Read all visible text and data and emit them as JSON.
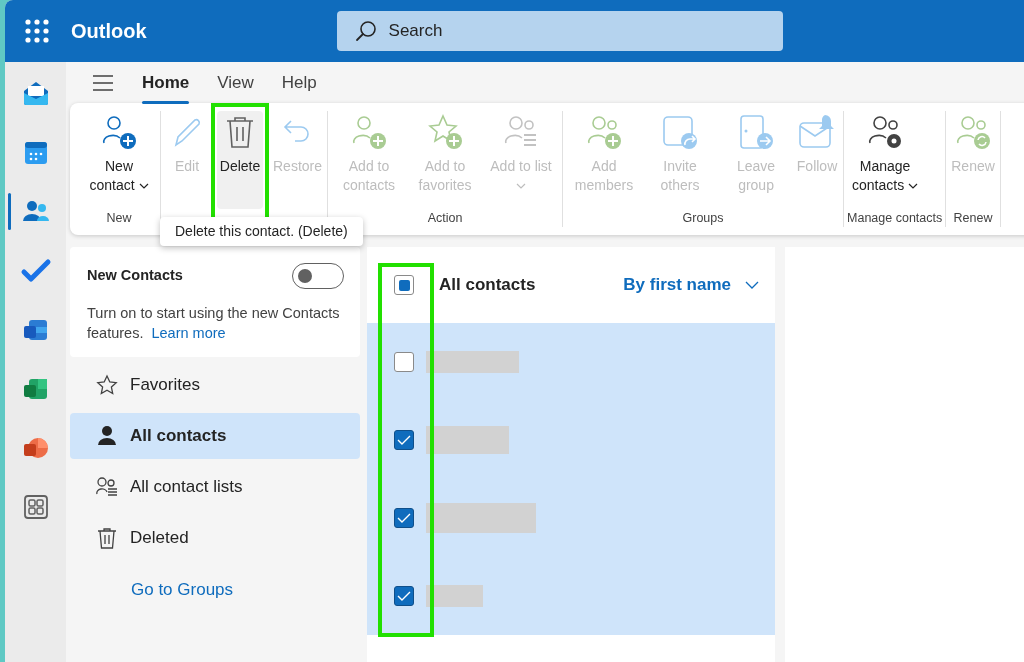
{
  "header": {
    "app_name": "Outlook",
    "search": {
      "placeholder": "Search"
    }
  },
  "app_rail": [
    {
      "kind": "mail",
      "selected": false
    },
    {
      "kind": "calendar",
      "selected": false
    },
    {
      "kind": "people",
      "selected": true
    },
    {
      "kind": "todo",
      "selected": false
    },
    {
      "kind": "word",
      "selected": false
    },
    {
      "kind": "excel",
      "selected": false
    },
    {
      "kind": "powerpoint",
      "selected": false
    },
    {
      "kind": "apps",
      "selected": false
    }
  ],
  "tabs": [
    {
      "label": "Home",
      "selected": true
    },
    {
      "label": "View",
      "selected": false
    },
    {
      "label": "Help",
      "selected": false
    }
  ],
  "ribbon": {
    "groups": [
      {
        "label": "New",
        "buttons": [
          {
            "kind": "new-contact",
            "label": "New contact",
            "dropdown": true,
            "disabled": false,
            "highlighted": false
          }
        ]
      },
      {
        "buttons": [
          {
            "kind": "edit",
            "label": "Edit",
            "dropdown": false,
            "disabled": true,
            "highlighted": false
          }
        ]
      },
      {
        "buttons": [
          {
            "kind": "delete",
            "label": "Delete",
            "dropdown": false,
            "disabled": false,
            "highlighted": true
          },
          {
            "kind": "restore",
            "label": "Restore",
            "dropdown": false,
            "disabled": true,
            "highlighted": false
          }
        ]
      },
      {
        "label": "Action",
        "buttons": [
          {
            "kind": "add-contact",
            "label": "Add to contacts",
            "dropdown": false,
            "disabled": true,
            "highlighted": false
          },
          {
            "kind": "add-favorite",
            "label": "Add to favorites",
            "dropdown": false,
            "disabled": true,
            "highlighted": false
          },
          {
            "kind": "add-list",
            "label": "Add to list",
            "dropdown": true,
            "disabled": true,
            "highlighted": false
          }
        ]
      },
      {
        "label": "Groups",
        "buttons": [
          {
            "kind": "add-members",
            "label": "Add members",
            "dropdown": false,
            "disabled": true,
            "highlighted": false
          },
          {
            "kind": "invite",
            "label": "Invite others",
            "dropdown": false,
            "disabled": true,
            "highlighted": false
          },
          {
            "kind": "leave",
            "label": "Leave group",
            "dropdown": false,
            "disabled": true,
            "highlighted": false
          },
          {
            "kind": "follow",
            "label": "Follow",
            "dropdown": false,
            "disabled": true,
            "highlighted": false
          }
        ]
      },
      {
        "label": "Manage contacts",
        "buttons": [
          {
            "kind": "manage",
            "label": "Manage contacts",
            "dropdown": true,
            "disabled": false,
            "highlighted": false
          }
        ]
      },
      {
        "label": "Renew",
        "buttons": [
          {
            "kind": "renew",
            "label": "Renew",
            "dropdown": false,
            "disabled": true,
            "highlighted": false
          }
        ]
      }
    ]
  },
  "tooltip": "Delete this contact. (Delete)",
  "promo": {
    "title": "New Contacts",
    "on": false,
    "text": "Turn on to start using the new Contacts features.",
    "link": "Learn more"
  },
  "nav": [
    {
      "kind": "favorites",
      "label": "Favorites",
      "selected": false
    },
    {
      "kind": "contacts",
      "label": "All contacts",
      "selected": true
    },
    {
      "kind": "lists",
      "label": "All contact lists",
      "selected": false
    },
    {
      "kind": "deleted",
      "label": "Deleted",
      "selected": false
    }
  ],
  "groups_link": "Go to Groups",
  "list": {
    "title": "All contacts",
    "sort": "By first name",
    "select_all": {
      "indeterminate": true
    },
    "highlight_checkboxes": true,
    "rows": [
      {
        "checked": false,
        "selected": true
      },
      {
        "checked": true,
        "selected": true
      },
      {
        "checked": true,
        "selected": true
      },
      {
        "checked": true,
        "selected": true
      }
    ]
  }
}
